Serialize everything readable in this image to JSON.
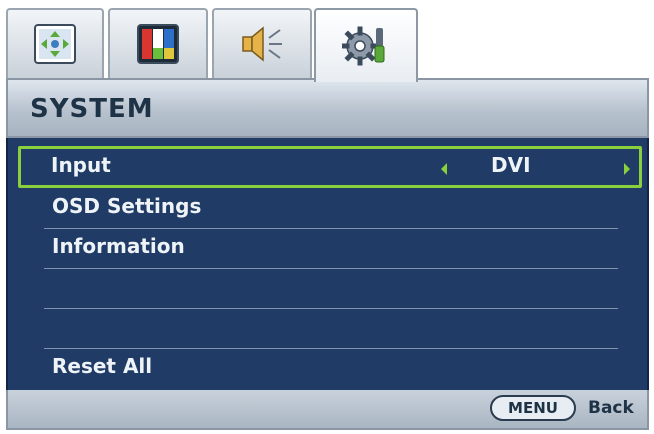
{
  "tabs": [
    {
      "icon": "picture-adjust-icon",
      "active": false
    },
    {
      "icon": "color-bars-icon",
      "active": false
    },
    {
      "icon": "speaker-icon",
      "active": false
    },
    {
      "icon": "system-settings-icon",
      "active": true
    }
  ],
  "header": {
    "title": "SYSTEM"
  },
  "menu": {
    "items": [
      {
        "label": "Input",
        "value": "DVI",
        "selected": true
      },
      {
        "label": "OSD Settings"
      },
      {
        "label": "Information"
      },
      {
        "label": ""
      },
      {
        "label": ""
      },
      {
        "label": "Reset All"
      }
    ]
  },
  "footer": {
    "menu_button": "MENU",
    "back_label": "Back"
  },
  "colors": {
    "accent_green": "#8ad03c",
    "menu_background": "#1f3b66",
    "header_text": "#1f3346"
  }
}
